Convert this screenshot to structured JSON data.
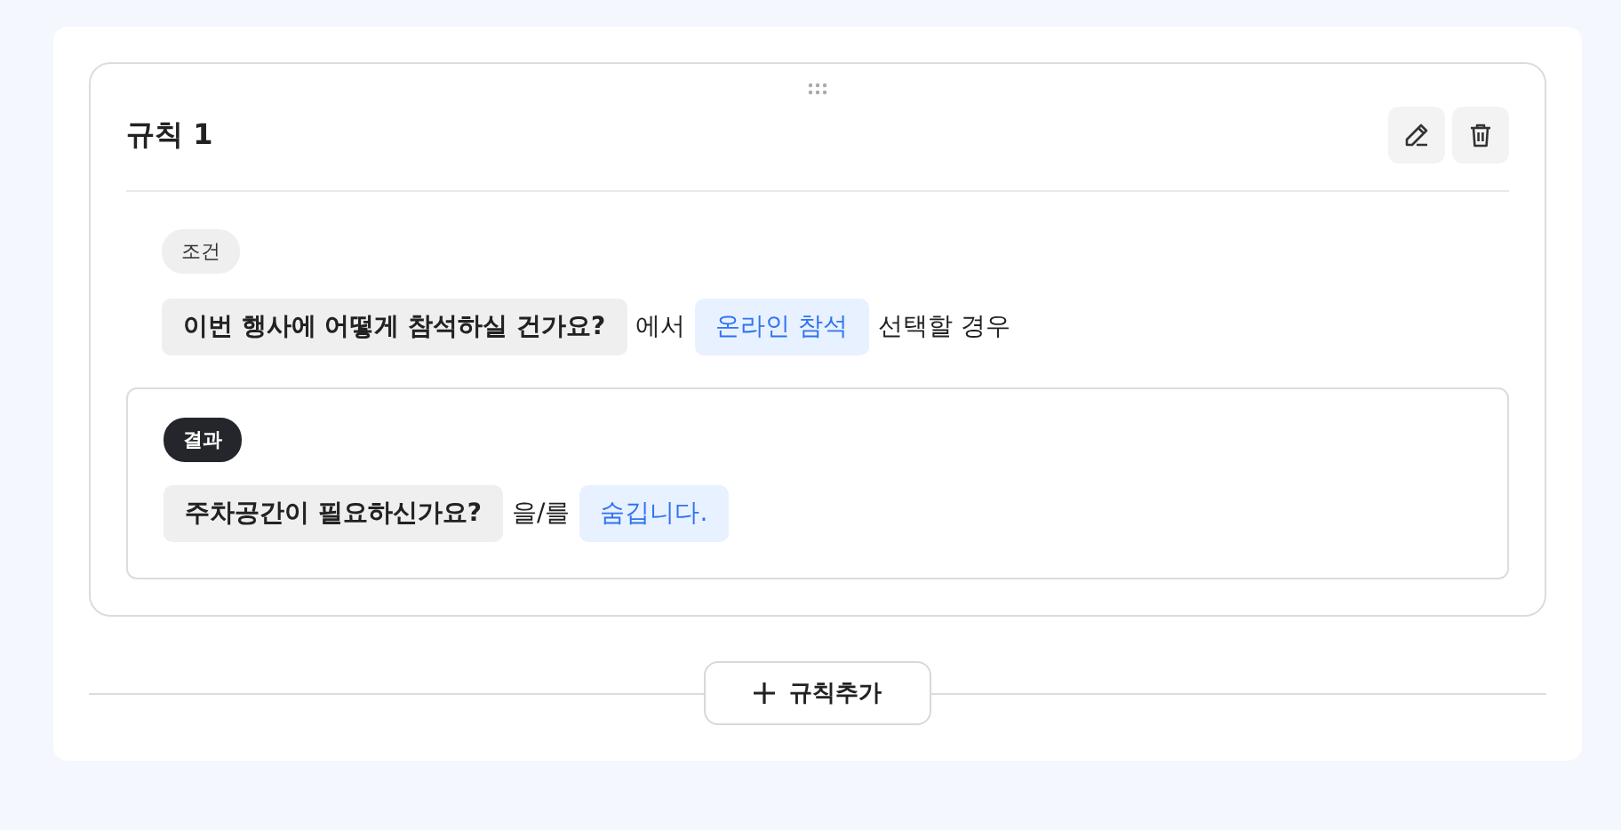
{
  "rule": {
    "title": "규칙 1",
    "condition": {
      "label": "조건",
      "question": "이번 행사에 어떻게 참석하실 건가요?",
      "connector": "에서",
      "answer": "온라인 참석",
      "suffix": "선택할 경우"
    },
    "result": {
      "label": "결과",
      "question": "주차공간이 필요하신가요?",
      "connector": "을/를",
      "action": "숨깁니다."
    }
  },
  "add_button": {
    "label": "규칙추가"
  }
}
